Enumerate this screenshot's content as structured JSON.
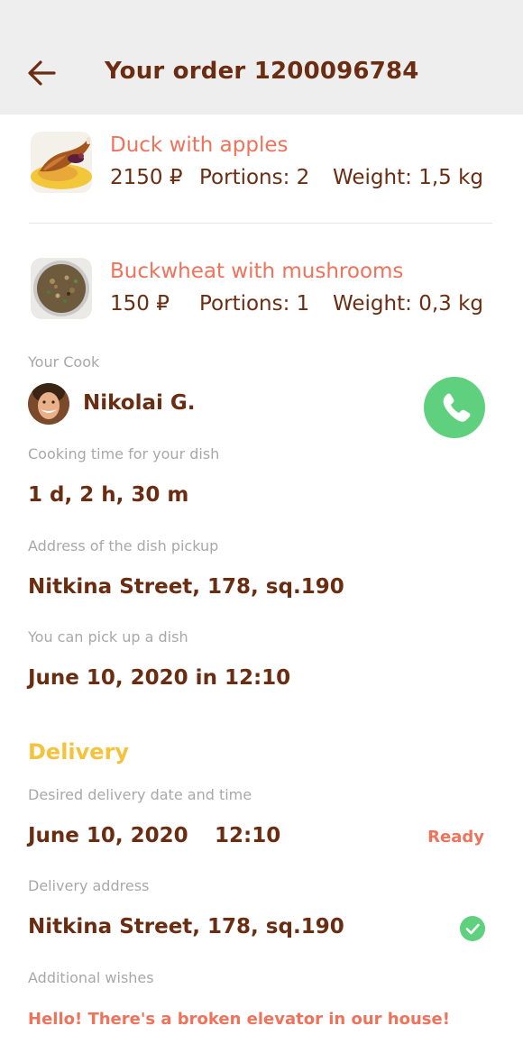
{
  "header": {
    "title": "Your order 1200096784"
  },
  "dishes": [
    {
      "name": "Duck with apples",
      "price": "2150 ₽",
      "portions": "Portions: 2",
      "weight": "Weight: 1,5 kg"
    },
    {
      "name": "Buckwheat with mushrooms",
      "price": "150 ₽",
      "portions": "Portions: 1",
      "weight": "Weight: 0,3 kg"
    }
  ],
  "cook": {
    "label": "Your Cook",
    "name": "Nikolai G."
  },
  "cooking_time": {
    "label": "Cooking time for your dish",
    "value": "1 d, 2 h, 30 m"
  },
  "pickup_address": {
    "label": "Address of the dish pickup",
    "value": "Nitkina Street, 178, sq.190"
  },
  "pickup_time": {
    "label": "You can pick up a dish",
    "value": "June 10, 2020 in 12:10"
  },
  "delivery": {
    "title": "Delivery",
    "date_label": "Desired delivery date and time",
    "date": "June 10, 2020",
    "time": "12:10",
    "status": "Ready",
    "address_label": "Delivery address",
    "address": "Nitkina Street, 178, sq.190",
    "wishes_label": "Additional wishes",
    "wishes": "Hello! There's a broken elevator in our house!"
  },
  "colors": {
    "accent": "#f0725a",
    "text": "#6b2d12",
    "delivery_title": "#f5c33b",
    "call_green": "#5fd07d",
    "header_bg": "#eeeeee"
  },
  "icons": {
    "back": "arrow-left-icon",
    "call": "phone-icon",
    "check": "check-circle-icon"
  }
}
